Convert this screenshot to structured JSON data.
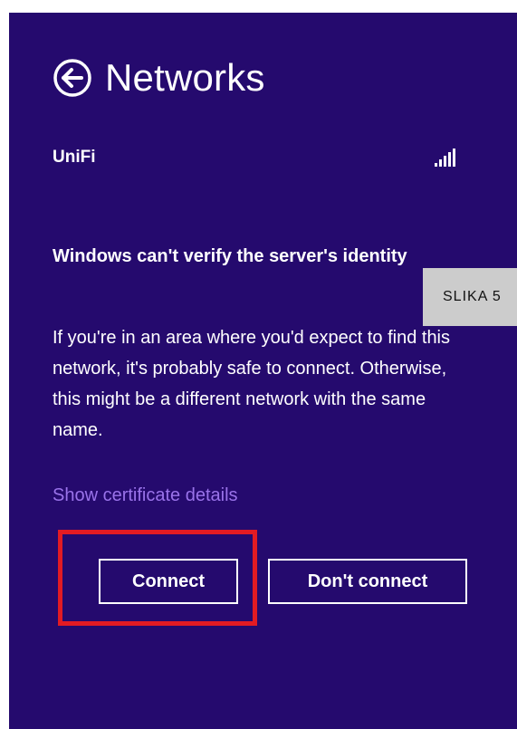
{
  "header": {
    "title": "Networks",
    "back_icon": "back-arrow-circle-icon"
  },
  "network": {
    "name": "UniFi",
    "signal_icon": "wifi-signal-icon"
  },
  "dialog": {
    "heading": "Windows can't verify the server's identity",
    "message": "If you're in an area where you'd expect to find this network, it's probably safe to connect. Otherwise, this might be a different network with the same name.",
    "certificate_link": "Show certificate details"
  },
  "buttons": {
    "connect": "Connect",
    "dont_connect": "Don't connect"
  },
  "annotation": {
    "label": "SLIKA 5",
    "highlight_color": "#e31b23"
  },
  "colors": {
    "background": "#250a6e",
    "link": "#9a73ea",
    "text": "#ffffff"
  }
}
